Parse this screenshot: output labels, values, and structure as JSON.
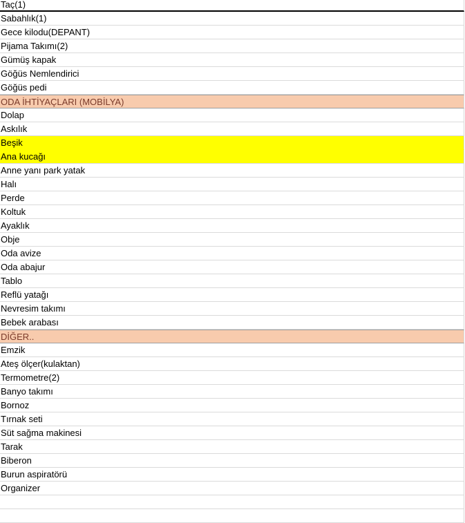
{
  "sheet": {
    "rows": [
      {
        "text": "Taç(1)",
        "kind": "first"
      },
      {
        "text": "Sabahlık(1)",
        "kind": "normal"
      },
      {
        "text": "Gece kilodu(DEPANT)",
        "kind": "normal"
      },
      {
        "text": "Pijama Takımı(2)",
        "kind": "normal"
      },
      {
        "text": "Gümüş kapak",
        "kind": "normal"
      },
      {
        "text": "Göğüs Nemlendirici",
        "kind": "normal"
      },
      {
        "text": "Göğüs pedi",
        "kind": "normal"
      },
      {
        "text": "ODA İHTİYAÇLARI (MOBİLYA)",
        "kind": "header"
      },
      {
        "text": "Dolap",
        "kind": "normal"
      },
      {
        "text": "Askılık",
        "kind": "normal"
      },
      {
        "text": "Beşik",
        "kind": "yellow"
      },
      {
        "text": "Ana kucağı",
        "kind": "yellow-last"
      },
      {
        "text": "Anne yanı park yatak",
        "kind": "normal"
      },
      {
        "text": "Halı",
        "kind": "normal"
      },
      {
        "text": "Perde",
        "kind": "normal"
      },
      {
        "text": "Koltuk",
        "kind": "normal"
      },
      {
        "text": "Ayaklık",
        "kind": "normal"
      },
      {
        "text": "Obje",
        "kind": "normal"
      },
      {
        "text": "Oda avize",
        "kind": "normal"
      },
      {
        "text": "Oda abajur",
        "kind": "normal"
      },
      {
        "text": "Tablo",
        "kind": "normal"
      },
      {
        "text": "Reflü yatağı",
        "kind": "normal"
      },
      {
        "text": "Nevresim takımı",
        "kind": "normal"
      },
      {
        "text": "Bebek arabası",
        "kind": "normal"
      },
      {
        "text": "DİĞER..",
        "kind": "header"
      },
      {
        "text": "Emzik",
        "kind": "normal"
      },
      {
        "text": "Ateş ölçer(kulaktan)",
        "kind": "normal"
      },
      {
        "text": "Termometre(2)",
        "kind": "normal"
      },
      {
        "text": "Banyo takımı",
        "kind": "normal"
      },
      {
        "text": "Bornoz",
        "kind": "normal"
      },
      {
        "text": "Tırnak seti",
        "kind": "normal"
      },
      {
        "text": "Süt sağma makinesi",
        "kind": "normal"
      },
      {
        "text": "Tarak",
        "kind": "normal"
      },
      {
        "text": "Biberon",
        "kind": "normal"
      },
      {
        "text": "Burun aspiratörü",
        "kind": "normal"
      },
      {
        "text": "Organizer",
        "kind": "normal"
      },
      {
        "text": "",
        "kind": "empty"
      },
      {
        "text": "",
        "kind": "empty"
      }
    ],
    "colors": {
      "header_fill": "#f8cbad",
      "highlight_fill": "#ffff00",
      "header_text": "#7a3a2a",
      "gridline": "#dadada"
    }
  }
}
